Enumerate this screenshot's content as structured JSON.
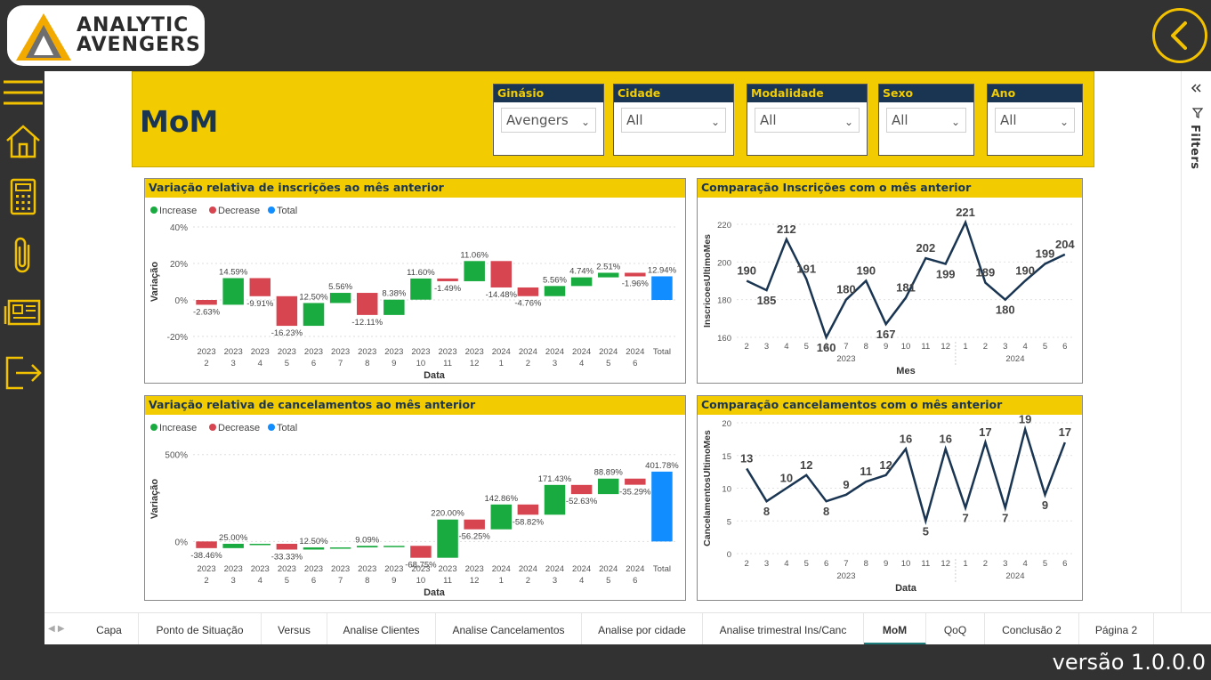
{
  "app": {
    "logo_text_line1": "ANALYTIC",
    "logo_text_line2": "AVENGERS",
    "version": "versão 1.0.0.0",
    "filters_label": "Filters"
  },
  "page": {
    "title": "MoM",
    "slicers": [
      {
        "label": "Ginásio",
        "value": "Avengers"
      },
      {
        "label": "Cidade",
        "value": "All"
      },
      {
        "label": "Modalidade",
        "value": "All"
      },
      {
        "label": "Sexo",
        "value": "All"
      },
      {
        "label": "Ano",
        "value": "All"
      }
    ]
  },
  "tabs": [
    {
      "label": "Capa",
      "active": false
    },
    {
      "label": "Ponto de Situação",
      "active": false
    },
    {
      "label": "Versus",
      "active": false
    },
    {
      "label": "Analise Clientes",
      "active": false
    },
    {
      "label": "Analise Cancelamentos",
      "active": false
    },
    {
      "label": "Analise por cidade",
      "active": false
    },
    {
      "label": "Analise trimestral Ins/Canc",
      "active": false
    },
    {
      "label": "MoM",
      "active": true
    },
    {
      "label": "QoQ",
      "active": false
    },
    {
      "label": "Conclusão 2",
      "active": false
    },
    {
      "label": "Página 2",
      "active": false
    }
  ],
  "colors": {
    "increase": "#1aab40",
    "decrease": "#d64550",
    "total": "#118dff",
    "line": "#1a3552",
    "accent": "#f2cc00"
  },
  "icons": [
    "hamburger-icon",
    "home-icon",
    "calculator-icon",
    "paperclip-icon",
    "newspaper-icon",
    "exit-icon",
    "back-arrow-icon"
  ],
  "chart_data": [
    {
      "type": "bar",
      "subtype": "waterfall",
      "title": "Variação relativa de inscrições ao mês anterior",
      "legend": [
        "Increase",
        "Decrease",
        "Total"
      ],
      "legend_position": "top-left",
      "xlabel": "Data",
      "ylabel": "Variação",
      "yticks": [
        "40%",
        "20%",
        "0%",
        "-20%"
      ],
      "ylim": [
        -20,
        40
      ],
      "categories": [
        [
          "2023",
          "2"
        ],
        [
          "2023",
          "3"
        ],
        [
          "2023",
          "4"
        ],
        [
          "2023",
          "5"
        ],
        [
          "2023",
          "6"
        ],
        [
          "2023",
          "7"
        ],
        [
          "2023",
          "8"
        ],
        [
          "2023",
          "9"
        ],
        [
          "2023",
          "10"
        ],
        [
          "2023",
          "11"
        ],
        [
          "2023",
          "12"
        ],
        [
          "2024",
          "1"
        ],
        [
          "2024",
          "2"
        ],
        [
          "2024",
          "3"
        ],
        [
          "2024",
          "4"
        ],
        [
          "2024",
          "5"
        ],
        [
          "2024",
          "6"
        ],
        [
          "Total",
          ""
        ]
      ],
      "values": [
        -2.63,
        14.59,
        -9.91,
        -16.23,
        12.5,
        5.56,
        -12.11,
        8.38,
        11.6,
        -1.49,
        11.06,
        -14.48,
        -4.76,
        5.56,
        4.74,
        2.51,
        -1.96,
        12.94
      ],
      "labels": [
        "-2.63%",
        "14.59%",
        "-9.91%",
        "-16.23%",
        "12.50%",
        "5.56%",
        "-12.11%",
        "8.38%",
        "11.60%",
        "-1.49%",
        "11.06%",
        "-14.48%",
        "-4.76%",
        "5.56%",
        "4.74%",
        "2.51%",
        "-1.96%",
        "12.94%"
      ]
    },
    {
      "type": "line",
      "title": "Comparação Inscrições com o mês anterior",
      "xlabel": "Mes",
      "ylabel": "InscricoesUltimoMes",
      "yticks": [
        "220",
        "200",
        "180",
        "160"
      ],
      "ylim": [
        160,
        220
      ],
      "x": [
        "2",
        "3",
        "4",
        "5",
        "6",
        "7",
        "8",
        "9",
        "10",
        "11",
        "12",
        "1",
        "2",
        "3",
        "4",
        "5",
        "6"
      ],
      "x_groups": [
        {
          "label": "2023"
        },
        {
          "label": "2024"
        }
      ],
      "values": [
        190,
        185,
        212,
        191,
        160,
        180,
        190,
        167,
        181,
        202,
        199,
        221,
        189,
        180,
        190,
        199,
        204
      ]
    },
    {
      "type": "bar",
      "subtype": "waterfall",
      "title": "Variação relativa de cancelamentos ao mês anterior",
      "legend": [
        "Increase",
        "Decrease",
        "Total"
      ],
      "legend_position": "top-left",
      "xlabel": "Data",
      "ylabel": "Variação",
      "yticks": [
        "500%",
        "0%"
      ],
      "ylim": [
        -70,
        560
      ],
      "categories": [
        [
          "2023",
          "2"
        ],
        [
          "2023",
          "3"
        ],
        [
          "2023",
          "4"
        ],
        [
          "2023",
          "5"
        ],
        [
          "2023",
          "6"
        ],
        [
          "2023",
          "7"
        ],
        [
          "2023",
          "8"
        ],
        [
          "2023",
          "9"
        ],
        [
          "2023",
          "10"
        ],
        [
          "2023",
          "11"
        ],
        [
          "2023",
          "12"
        ],
        [
          "2024",
          "1"
        ],
        [
          "2024",
          "2"
        ],
        [
          "2024",
          "3"
        ],
        [
          "2024",
          "4"
        ],
        [
          "2024",
          "5"
        ],
        [
          "2024",
          "6"
        ],
        [
          "Total",
          ""
        ]
      ],
      "values": [
        -38.46,
        25.0,
        0,
        -33.33,
        12.5,
        0,
        9.09,
        0,
        -68.75,
        220.0,
        -56.25,
        142.86,
        -58.82,
        171.43,
        -52.63,
        88.89,
        -35.29,
        401.78
      ],
      "labels": [
        "-38.46%",
        "25.00%",
        "",
        "-33.33%",
        "12.50%",
        "",
        "9.09%",
        "",
        "-68.75%",
        "220.00%",
        "-56.25%",
        "142.86%",
        "-58.82%",
        "171.43%",
        "-52.63%",
        "88.89%",
        "-35.29%",
        "401.78%"
      ]
    },
    {
      "type": "line",
      "title": "Comparação cancelamentos com o mês anterior",
      "xlabel": "Data",
      "ylabel": "CancelamentosUltimoMes",
      "yticks": [
        "20",
        "15",
        "10",
        "5",
        "0"
      ],
      "ylim": [
        0,
        20
      ],
      "x": [
        "2",
        "3",
        "4",
        "5",
        "6",
        "7",
        "8",
        "9",
        "10",
        "11",
        "12",
        "1",
        "2",
        "3",
        "4",
        "5",
        "6"
      ],
      "x_groups": [
        {
          "label": "2023"
        },
        {
          "label": "2024"
        }
      ],
      "values": [
        13,
        8,
        10,
        12,
        8,
        9,
        11,
        12,
        16,
        5,
        16,
        7,
        17,
        7,
        19,
        9,
        17
      ]
    }
  ]
}
